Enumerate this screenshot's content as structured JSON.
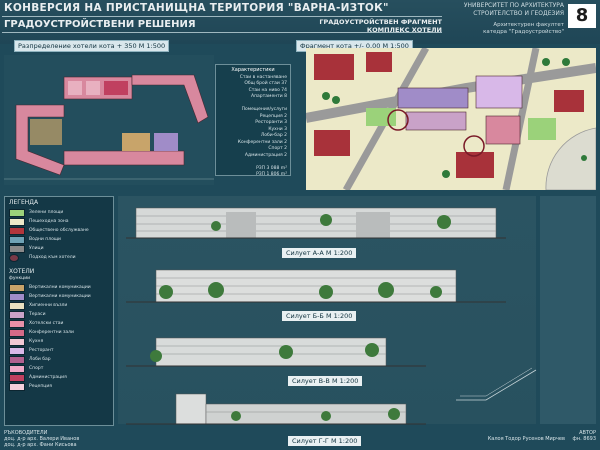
{
  "header": {
    "title": "КОНВЕРСИЯ НА ПРИСТАНИЩНА ТЕРИТОРИЯ \"ВАРНА-ИЗТОК\"",
    "subtitle": "ГРАДОУСТРОЙСТВЕНИ РЕШЕНИЯ",
    "university_lines": [
      "УНИВЕРСИТЕТ ПО АРХИТЕКТУРА",
      "СТРОИТЕЛСТВО И ГЕОДЕЗИЯ"
    ],
    "faculty_lines": [
      "Архитектурен факултет",
      "катедра \"Градоустройство\""
    ],
    "sheet_number": "8"
  },
  "fragment_title": [
    "ГРАДОУСТРОЙСТВЕН ФРАГМЕНТ",
    "КОМПЛЕКС ХОТЕЛИ"
  ],
  "plan_left": {
    "label": "Разпределение хотели кота + 350 М 1:500"
  },
  "plan_right": {
    "label": "Фрагмент кота +/- 0,00 М 1:500"
  },
  "features": {
    "heading": "Характеристики",
    "lines": [
      "Стаи в настаняване",
      "Общ брой стаи 37",
      "Стаи на ниво 74",
      "Апартаменти 8",
      "",
      "Помещения/услуги",
      "Рецепция 2",
      "Ресторанти 3",
      "Кухни 3",
      "Лоби-бар 2",
      "Конферентни зали 2",
      "Спорт 2",
      "Администрация 2",
      "",
      "РЗП 3 088 m²",
      "РЗП 1 806 m²"
    ]
  },
  "legend": {
    "title": "ЛЕГЕНДА",
    "items": [
      {
        "label": "Зелени площи",
        "color": "#9bd27a"
      },
      {
        "label": "Пешеходна зона",
        "color": "#ece9c8"
      },
      {
        "label": "Обществено обслужване",
        "color": "#b2363c"
      },
      {
        "label": "Водни площи",
        "color": "#6fa3b6"
      },
      {
        "label": "Улици",
        "color": "#8a8a8a"
      },
      {
        "label": "Подход към хотели",
        "color": "#7a3a48"
      }
    ],
    "hotels_title": "ХОТЕЛИ",
    "hotels_subtitle": "функции",
    "hotel_items": [
      {
        "label": "Вертикални комуникации",
        "color": "#c8a46a"
      },
      {
        "label": "Вертикални комуникации",
        "color": "#a08cc8"
      },
      {
        "label": "Хигиенни възли",
        "color": "#e8e0c0"
      },
      {
        "label": "Тераси",
        "color": "#c9a2c8"
      },
      {
        "label": "Хотелски стаи",
        "color": "#e890a8"
      },
      {
        "label": "Конферентни зали",
        "color": "#d46a88"
      },
      {
        "label": "Кухня",
        "color": "#f0c8d4"
      },
      {
        "label": "Ресторант",
        "color": "#d8b8e8"
      },
      {
        "label": "Лоби бар",
        "color": "#b06090"
      },
      {
        "label": "Спорт",
        "color": "#f0a8c8"
      },
      {
        "label": "Администрация",
        "color": "#c04060"
      },
      {
        "label": "Рецепция",
        "color": "#f4d0dc"
      }
    ]
  },
  "sections": [
    {
      "label": "Силует А-А М 1:200"
    },
    {
      "label": "Силует Б-Б М 1:200"
    },
    {
      "label": "Силует В-В М 1:200"
    },
    {
      "label": "Силует Г-Г М 1:200"
    }
  ],
  "supervisors": {
    "heading": "РЪКОВОДИТЕЛИ",
    "lines": [
      "доц. д-р арх. Валери Иванов",
      "доц. д-р арх. Фани Кисьова"
    ]
  },
  "author": {
    "heading": "АВТОР",
    "name": "Калоя Тодор Русенов Мирчев",
    "number": "фн. 8693"
  },
  "colors": {
    "background": "#1f4a5a",
    "accent_red": "#a8323a",
    "pink": "#d88aa0"
  }
}
